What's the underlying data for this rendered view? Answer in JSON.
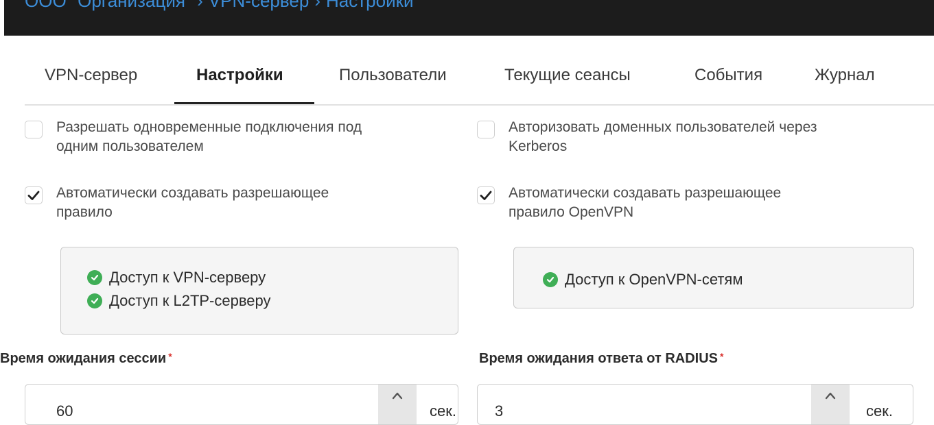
{
  "breadcrumb": {
    "org": "ООО \"Организация\"",
    "section": "VPN-сервер",
    "page": "Настройки"
  },
  "tabs": [
    {
      "label": "VPN-сервер",
      "active": false
    },
    {
      "label": "Настройки",
      "active": true
    },
    {
      "label": "Пользователи",
      "active": false
    },
    {
      "label": "Текущие сеансы",
      "active": false
    },
    {
      "label": "События",
      "active": false
    },
    {
      "label": "Журнал",
      "active": false
    }
  ],
  "options": {
    "simultaneous": {
      "line1": "Разрешать одновременные подключения под",
      "line2": "одним пользователем",
      "checked": false
    },
    "kerberos": {
      "line1": "Авторизовать доменных пользователей через",
      "line2": "Kerberos",
      "checked": false
    },
    "auto_rule": {
      "line1": "Автоматически создавать разрешающее",
      "line2": "правило",
      "checked": true
    },
    "auto_rule_openvpn": {
      "line1": "Автоматически создавать разрешающее",
      "line2": "правило OpenVPN",
      "checked": true
    }
  },
  "permissions_left": [
    "Доступ к VPN-серверу",
    "Доступ к L2TP-серверу"
  ],
  "permissions_right": [
    "Доступ к OpenVPN-сетям"
  ],
  "fields": {
    "session_timeout": {
      "label": "Время ожидания сессии",
      "required_mark": "*",
      "value": "60",
      "unit": "сек."
    },
    "radius_timeout": {
      "label": "Время ожидания ответа от RADIUS",
      "required_mark": "*",
      "value": "3",
      "unit": "сек."
    }
  },
  "colors": {
    "topbar": "#1c1c1c",
    "link": "#3c8dd8",
    "ok": "#3fae56",
    "required": "#d9302c"
  }
}
